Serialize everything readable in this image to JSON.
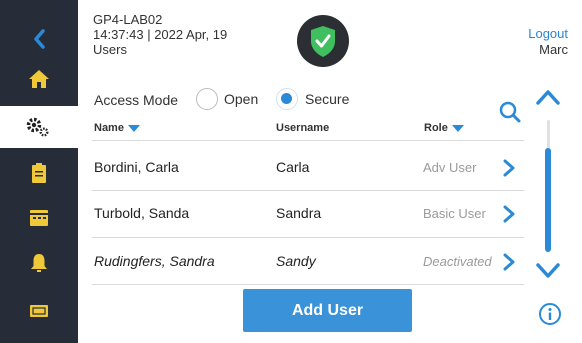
{
  "header": {
    "device": "GP4-LAB02",
    "datetime": "14:37:43 | 2022 Apr, 19",
    "page": "Users",
    "logout_label": "Logout",
    "user": "Marc"
  },
  "sidebar": {
    "items": [
      {
        "icon": "back-arrow-icon"
      },
      {
        "icon": "home-icon"
      },
      {
        "icon": "settings-gears-icon",
        "active": true
      },
      {
        "icon": "clipboard-icon"
      },
      {
        "icon": "calendar-icon"
      },
      {
        "icon": "bell-icon"
      },
      {
        "icon": "ticket-icon"
      }
    ]
  },
  "access_mode": {
    "label": "Access Mode",
    "options": [
      "Open",
      "Secure"
    ],
    "selected": "Secure"
  },
  "table": {
    "columns": [
      "Name",
      "Username",
      "Role"
    ],
    "rows": [
      {
        "name": "Bordini, Carla",
        "username": "Carla",
        "role": "Adv User"
      },
      {
        "name": "Turbold, Sanda",
        "username": "Sandra",
        "role": "Basic User"
      },
      {
        "name": "Rudingfers, Sandra",
        "username": "Sandy",
        "role": "Deactivated"
      }
    ]
  },
  "add_user_label": "Add User",
  "colors": {
    "accent": "#2a8ad8",
    "sidebar_bg": "#262d38",
    "sidebar_icon": "#f0c93a",
    "secure_green": "#3fbf5f",
    "shield_bg": "#2b2f33"
  }
}
